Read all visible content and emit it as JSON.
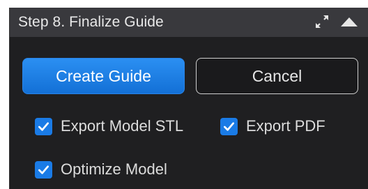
{
  "panel": {
    "title": "Step 8. Finalize Guide",
    "icons": [
      "expand-icon",
      "collapse-up-icon"
    ]
  },
  "actions": {
    "create_label": "Create Guide",
    "cancel_label": "Cancel"
  },
  "options": [
    {
      "label": "Export Model STL",
      "checked": true
    },
    {
      "label": "Export PDF",
      "checked": true
    },
    {
      "label": "Optimize Model",
      "checked": true
    }
  ],
  "colors": {
    "accent": "#1a7be6",
    "panel_bg": "#1f1f21",
    "header_bg": "#39393d"
  }
}
